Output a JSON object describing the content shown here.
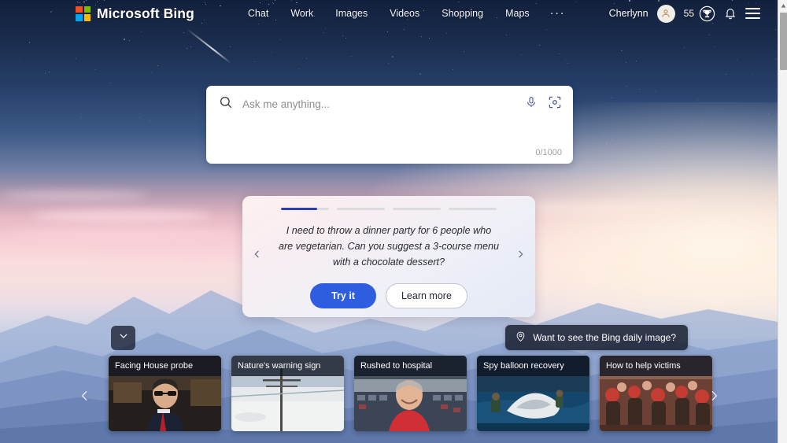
{
  "brand": {
    "name": "Microsoft Bing",
    "logo_icon": "microsoft-logo-icon",
    "colors": {
      "red": "#f25022",
      "green": "#7fba00",
      "blue": "#00a4ef",
      "yellow": "#ffb900"
    }
  },
  "nav": {
    "items": [
      {
        "label": "Chat"
      },
      {
        "label": "Work"
      },
      {
        "label": "Images"
      },
      {
        "label": "Videos"
      },
      {
        "label": "Shopping"
      },
      {
        "label": "Maps"
      }
    ],
    "overflow_label": "···"
  },
  "account": {
    "username": "Cherlynn",
    "avatar_icon": "person-avatar-icon",
    "rewards_count": "55",
    "rewards_icon": "trophy-icon",
    "notifications_icon": "bell-icon",
    "menu_icon": "hamburger-menu-icon"
  },
  "search": {
    "placeholder": "Ask me anything...",
    "value": "",
    "counter": "0/1000",
    "search_icon": "search-icon",
    "mic_icon": "microphone-icon",
    "camera_icon": "visual-search-camera-icon"
  },
  "suggestion_card": {
    "progress": [
      76,
      0,
      0,
      0
    ],
    "accent_color": "#2b3fa8",
    "text": "I need to throw a dinner party for 6 people who are vegetarian. Can you suggest a 3-course menu with a chocolate dessert?",
    "try_label": "Try it",
    "learn_label": "Learn more",
    "prev_icon": "chevron-left-icon",
    "next_icon": "chevron-right-icon"
  },
  "daily_image": {
    "label": "Want to see the Bing daily image?",
    "icon": "location-pin-icon"
  },
  "expand_button": {
    "icon": "chevron-down-icon"
  },
  "news": {
    "prev_icon": "chevron-left-icon",
    "next_icon": "chevron-right-icon",
    "cards": [
      {
        "title": "Facing House probe",
        "theme": "courtroom-portrait"
      },
      {
        "title": "Nature's warning sign",
        "theme": "snow-pole-landscape"
      },
      {
        "title": "Rushed to hospital",
        "theme": "stadium-crowd-portrait"
      },
      {
        "title": "Spy balloon recovery",
        "theme": "navy-ship-debris"
      },
      {
        "title": "How to help victims",
        "theme": "crowd-aid-scene"
      }
    ]
  },
  "scrollbar": {
    "up_icon": "scroll-up-arrow-icon",
    "thumb": "scrollbar-thumb"
  }
}
